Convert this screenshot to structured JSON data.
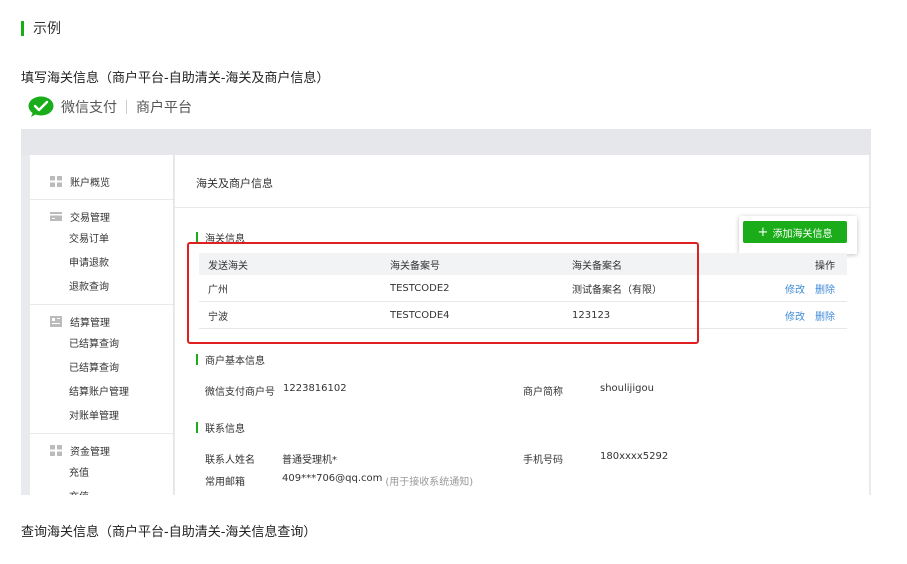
{
  "doc": {
    "section_label": "示例",
    "line1": "填写海关信息（商户平台-自助清关-海关及商户信息）",
    "line2": "查询海关信息（商户平台-自助清关-海关信息查询）"
  },
  "brand": {
    "wechat_pay": "微信支付",
    "merchant_platform": "商户平台",
    "logo_color": "#1aad19"
  },
  "sidebar": {
    "overview": "账户概览",
    "groups": [
      {
        "title": "交易管理",
        "items": [
          "交易订单",
          "申请退款",
          "退款查询"
        ]
      },
      {
        "title": "结算管理",
        "items": [
          "已结算查询",
          "已结算查询",
          "结算账户管理",
          "对账单管理"
        ]
      },
      {
        "title": "资金管理",
        "items": [
          "充值",
          "充值"
        ]
      }
    ]
  },
  "main": {
    "page_title": "海关及商户信息",
    "customs_section": "海关信息",
    "add_button": "添加海关信息",
    "table": {
      "headers": [
        "发送海关",
        "海关备案号",
        "海关备案名",
        "操作"
      ],
      "rows": [
        {
          "customs": "广州",
          "code": "TESTCODE2",
          "name": "测试备案名（有限）",
          "edit": "修改",
          "delete": "删除"
        },
        {
          "customs": "宁波",
          "code": "TESTCODE4",
          "name": "123123",
          "edit": "修改",
          "delete": "删除"
        }
      ]
    },
    "merchant_section": "商户基本信息",
    "merchant": {
      "id_label": "微信支付商户号",
      "id_value": "1223816102",
      "short_label": "商户简称",
      "short_value": "shoulijigou"
    },
    "contact_section": "联系信息",
    "contact": {
      "name_label": "联系人姓名",
      "name_value": "普通受理机*",
      "phone_label": "手机号码",
      "phone_value": "180xxxx5292",
      "email_label": "常用邮箱",
      "email_value": "409***706@qq.com",
      "email_hint": "(用于接收系统通知)"
    }
  },
  "colors": {
    "accent": "#1aad19",
    "link": "#3f8bd8",
    "highlight_box": "#e02020"
  }
}
